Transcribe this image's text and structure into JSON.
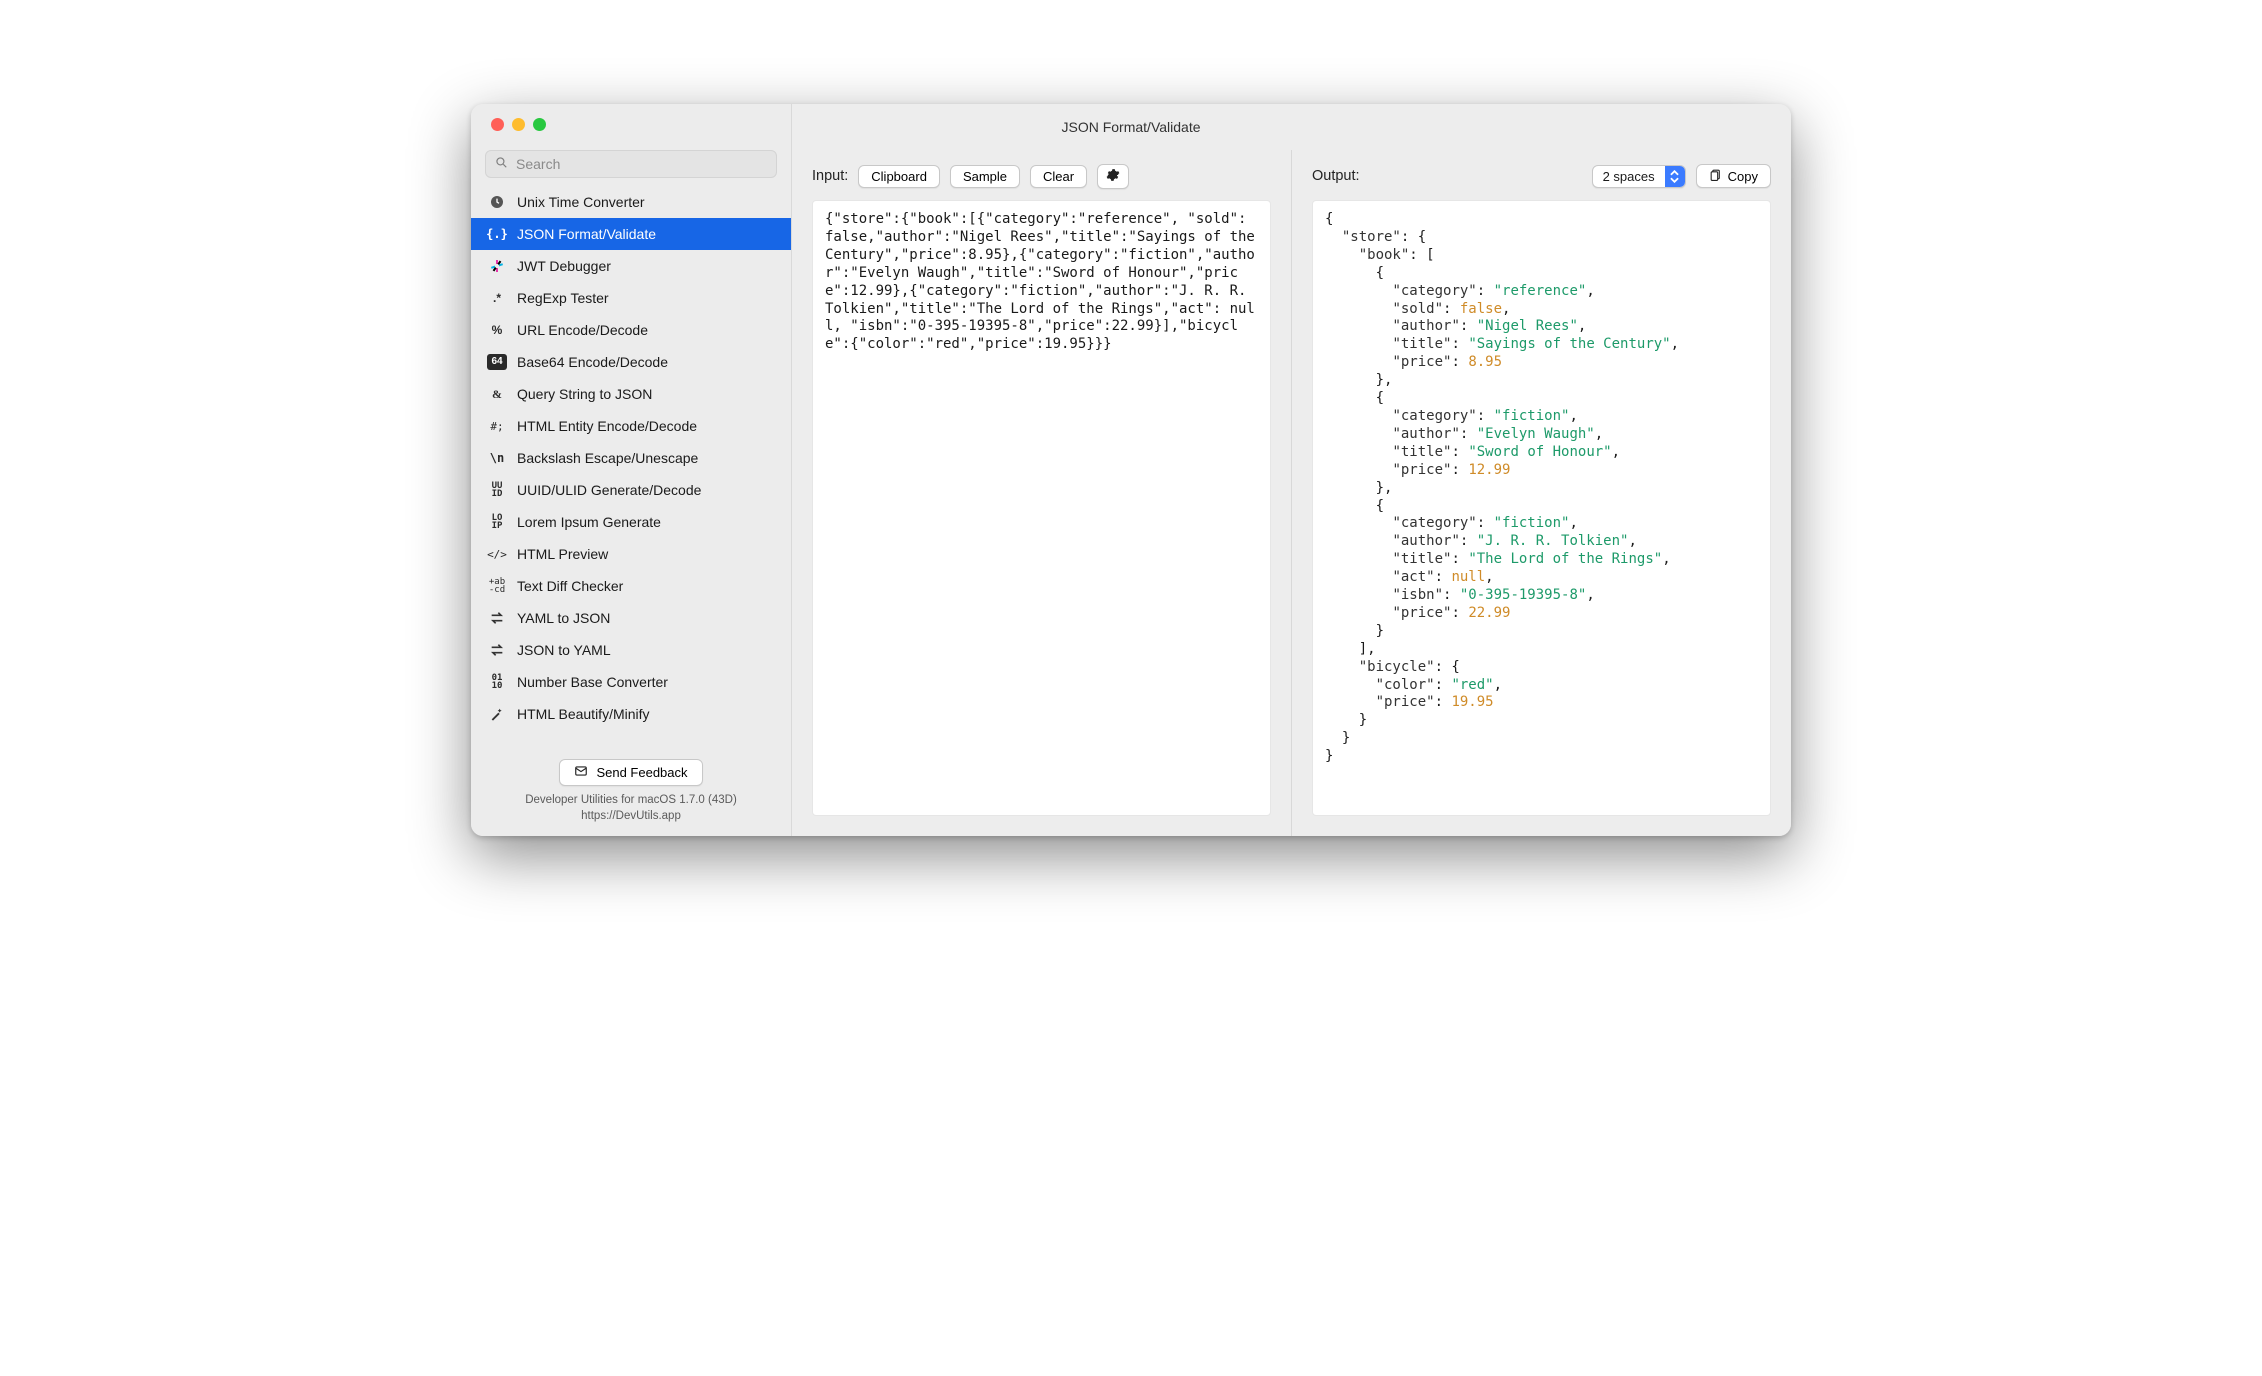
{
  "window": {
    "title": "JSON Format/Validate"
  },
  "search": {
    "placeholder": "Search"
  },
  "sidebar": {
    "items": [
      {
        "label": "Unix Time Converter",
        "icon": "clock-icon",
        "active": false
      },
      {
        "label": "JSON Format/Validate",
        "icon": "braces-icon",
        "active": true
      },
      {
        "label": "JWT Debugger",
        "icon": "jwt-icon",
        "active": false
      },
      {
        "label": "RegExp Tester",
        "icon": "regex-icon",
        "active": false
      },
      {
        "label": "URL Encode/Decode",
        "icon": "percent-icon",
        "active": false
      },
      {
        "label": "Base64 Encode/Decode",
        "icon": "64-badge-icon",
        "active": false
      },
      {
        "label": "Query String to JSON",
        "icon": "ampersand-icon",
        "active": false
      },
      {
        "label": "HTML Entity Encode/Decode",
        "icon": "hash-semicolon-icon",
        "active": false
      },
      {
        "label": "Backslash Escape/Unescape",
        "icon": "backslash-n-icon",
        "active": false
      },
      {
        "label": "UUID/ULID Generate/Decode",
        "icon": "uuid-icon",
        "active": false
      },
      {
        "label": "Lorem Ipsum Generate",
        "icon": "loip-icon",
        "active": false
      },
      {
        "label": "HTML Preview",
        "icon": "code-tag-icon",
        "active": false
      },
      {
        "label": "Text Diff Checker",
        "icon": "abcd-icon",
        "active": false
      },
      {
        "label": "YAML to JSON",
        "icon": "swap-icon",
        "active": false
      },
      {
        "label": "JSON to YAML",
        "icon": "swap-icon",
        "active": false
      },
      {
        "label": "Number Base Converter",
        "icon": "binary-icon",
        "active": false
      },
      {
        "label": "HTML Beautify/Minify",
        "icon": "wand-icon",
        "active": false
      }
    ]
  },
  "footer": {
    "feedback_label": "Send Feedback",
    "line1": "Developer Utilities for macOS 1.7.0 (43D)",
    "line2": "https://DevUtils.app"
  },
  "input_pane": {
    "label": "Input:",
    "buttons": {
      "clipboard": "Clipboard",
      "sample": "Sample",
      "clear": "Clear"
    },
    "content": "{\"store\":{\"book\":[{\"category\":\"reference\", \"sold\": false,\"author\":\"Nigel Rees\",\"title\":\"Sayings of the Century\",\"price\":8.95},{\"category\":\"fiction\",\"author\":\"Evelyn Waugh\",\"title\":\"Sword of Honour\",\"price\":12.99},{\"category\":\"fiction\",\"author\":\"J. R. R. Tolkien\",\"title\":\"The Lord of the Rings\",\"act\": null, \"isbn\":\"0-395-19395-8\",\"price\":22.99}],\"bicycle\":{\"color\":\"red\",\"price\":19.95}}}"
  },
  "output_pane": {
    "label": "Output:",
    "indent_selected": "2 spaces",
    "copy_label": "Copy",
    "json": {
      "store": {
        "book": [
          {
            "category": "reference",
            "sold": false,
            "author": "Nigel Rees",
            "title": "Sayings of the Century",
            "price": 8.95
          },
          {
            "category": "fiction",
            "author": "Evelyn Waugh",
            "title": "Sword of Honour",
            "price": 12.99
          },
          {
            "category": "fiction",
            "author": "J. R. R. Tolkien",
            "title": "The Lord of the Rings",
            "act": null,
            "isbn": "0-395-19395-8",
            "price": 22.99
          }
        ],
        "bicycle": {
          "color": "red",
          "price": 19.95
        }
      }
    }
  },
  "colors": {
    "string": "#1d9a69",
    "number": "#cf8b28",
    "null": "#cf8b28",
    "bool": "#cf8b28"
  }
}
